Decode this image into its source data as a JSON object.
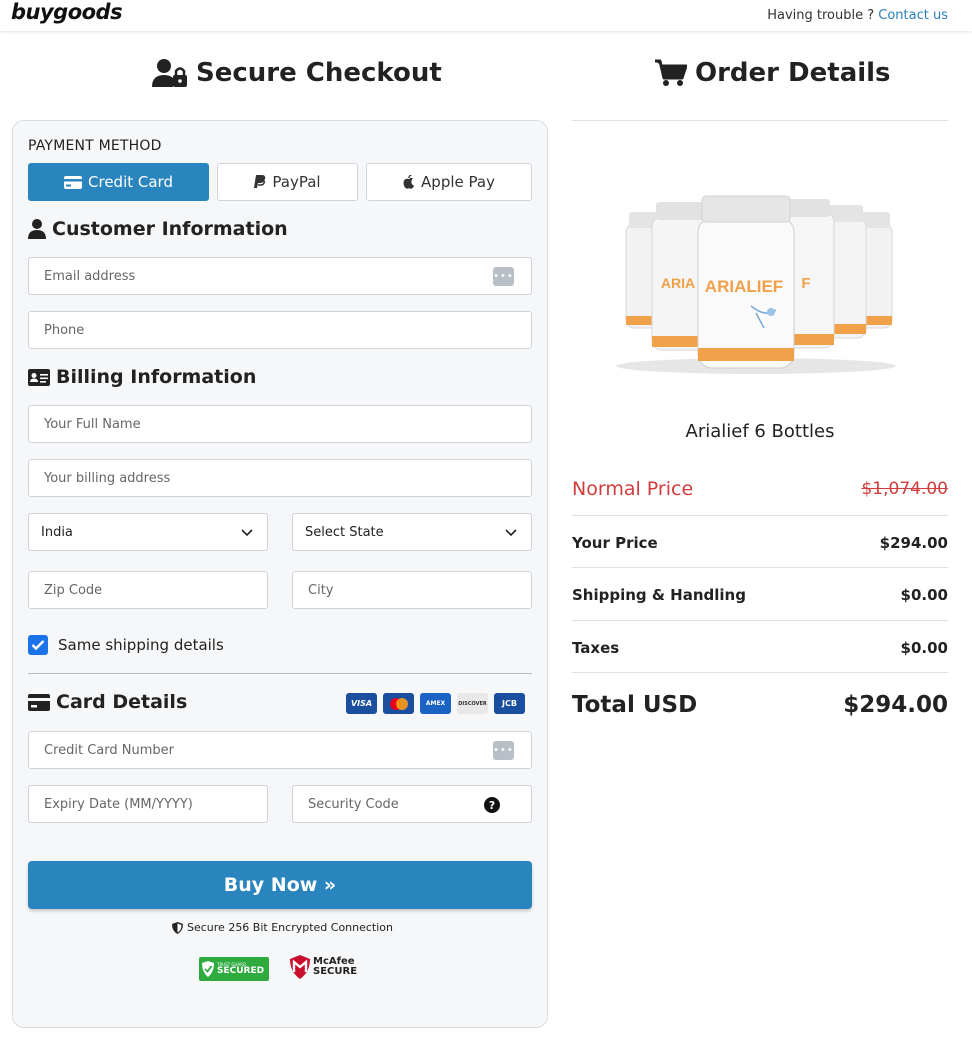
{
  "header": {
    "logo": "buygoods",
    "trouble_text": "Having trouble ?",
    "contact_link": "Contact us"
  },
  "checkout": {
    "title": "Secure Checkout",
    "payment_method_label": "PAYMENT METHOD",
    "payment_methods": {
      "credit_card": "Credit Card",
      "paypal": "PayPal",
      "apple_pay": "Apple Pay"
    },
    "customer_info_title": "Customer Information",
    "email_placeholder": "Email address",
    "phone_placeholder": "Phone",
    "billing_info_title": "Billing Information",
    "full_name_placeholder": "Your Full Name",
    "billing_address_placeholder": "Your billing address",
    "country_value": "India",
    "state_value": "Select State",
    "zip_placeholder": "Zip Code",
    "city_placeholder": "City",
    "same_shipping_label": "Same shipping details",
    "same_shipping_checked": true,
    "card_details_title": "Card Details",
    "card_logos": [
      "VISA",
      "Mastercard",
      "AMEX",
      "DISCOVER",
      "JCB"
    ],
    "card_number_placeholder": "Credit Card Number",
    "expiry_placeholder": "Expiry Date (MM/YYYY)",
    "security_code_placeholder": "Security Code",
    "buy_button": "Buy Now »",
    "secure_text": "Secure 256 Bit Encrypted Connection",
    "badges": {
      "trustguard_small": "TRUST GUARD",
      "trustguard_big": "SECURED",
      "mcafee_top": "McAfee",
      "mcafee_bottom": "SECURE"
    }
  },
  "order": {
    "title": "Order Details",
    "product_name": "Arialief 6 Bottles",
    "product_label": "ARIALIEF",
    "normal_price_label": "Normal Price",
    "normal_price": "$1,074.00",
    "your_price_label": "Your Price",
    "your_price": "$294.00",
    "shipping_label": "Shipping & Handling",
    "shipping": "$0.00",
    "taxes_label": "Taxes",
    "taxes": "$0.00",
    "total_label": "Total USD",
    "total": "$294.00"
  },
  "colors": {
    "primary": "#2a84bd",
    "link": "#2a7fb8",
    "strike_red": "#d23c3c",
    "checkbox_blue": "#1a73e8",
    "card_bg": "#f6f7f9",
    "trustguard_green": "#2eaa3f",
    "bottle_orange": "#f0a14a"
  }
}
